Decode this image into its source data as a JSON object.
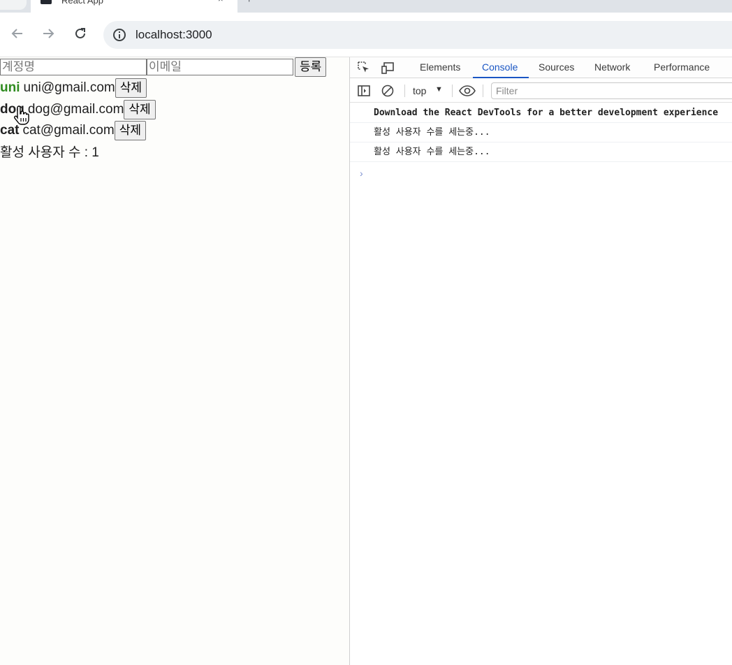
{
  "browser": {
    "tab_title": "React App",
    "tab_close": "×",
    "new_tab": "+",
    "url": "localhost:3000"
  },
  "app": {
    "username_placeholder": "계정명",
    "email_placeholder": "이메일",
    "register_label": "등록",
    "delete_label": "삭제",
    "users": [
      {
        "username": "uni",
        "email": "uni@gmail.com",
        "active": true
      },
      {
        "username": "dog",
        "email": "dog@gmail.com",
        "active": false
      },
      {
        "username": "cat",
        "email": "cat@gmail.com",
        "active": false
      }
    ],
    "active_count_text": "활성 사용자 수 : 1"
  },
  "colors": {
    "active_user": "#2e8b1e",
    "inactive_user": "#000000",
    "devtools_accent": "#1a56c4"
  },
  "devtools": {
    "tabs": [
      "Elements",
      "Console",
      "Sources",
      "Network",
      "Performance"
    ],
    "active_tab": "Console",
    "context": "top",
    "filter_placeholder": "Filter",
    "console_lines": [
      "Download the React DevTools for a better development experience",
      "활성 사용자 수를 세는중...",
      "활성 사용자 수를 세는중..."
    ],
    "prompt": "›"
  }
}
